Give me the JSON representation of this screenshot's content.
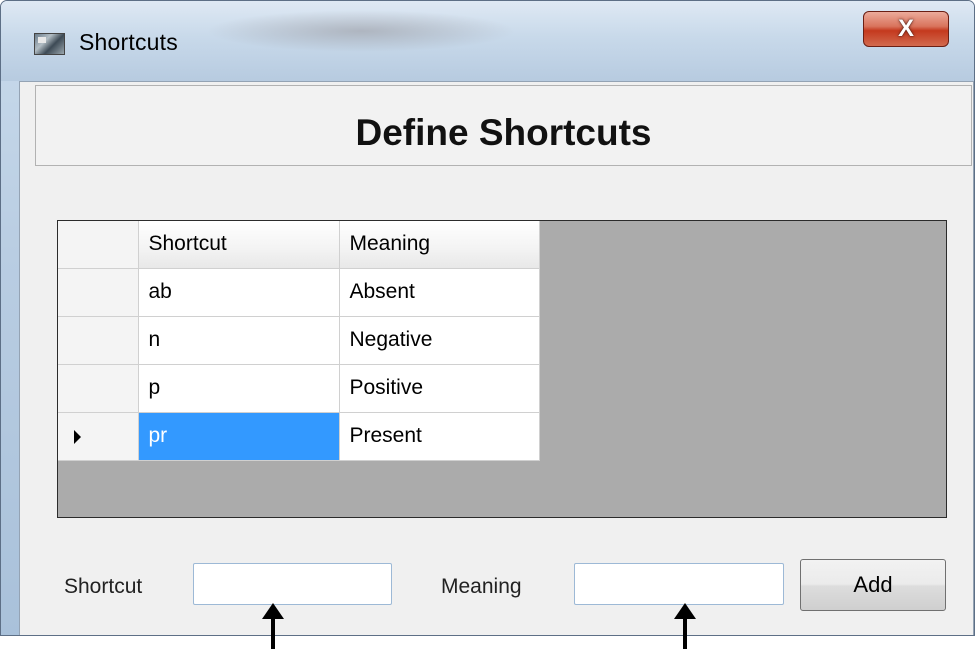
{
  "window": {
    "title": "Shortcuts",
    "close_label": "X"
  },
  "header": {
    "title": "Define Shortcuts"
  },
  "grid": {
    "columns": [
      "Shortcut",
      "Meaning"
    ],
    "rows": [
      {
        "shortcut": "ab",
        "meaning": "Absent"
      },
      {
        "shortcut": "n",
        "meaning": "Negative"
      },
      {
        "shortcut": "p",
        "meaning": "Positive"
      },
      {
        "shortcut": "pr",
        "meaning": "Present"
      }
    ],
    "current_row": 3,
    "selected_cell": "pr"
  },
  "form": {
    "shortcut_label": "Shortcut",
    "shortcut_value": "",
    "meaning_label": "Meaning",
    "meaning_value": "",
    "add_label": "Add"
  },
  "colors": {
    "selection": "#3399ff",
    "grid_background": "#ababab",
    "close_button": "#c4391e"
  }
}
